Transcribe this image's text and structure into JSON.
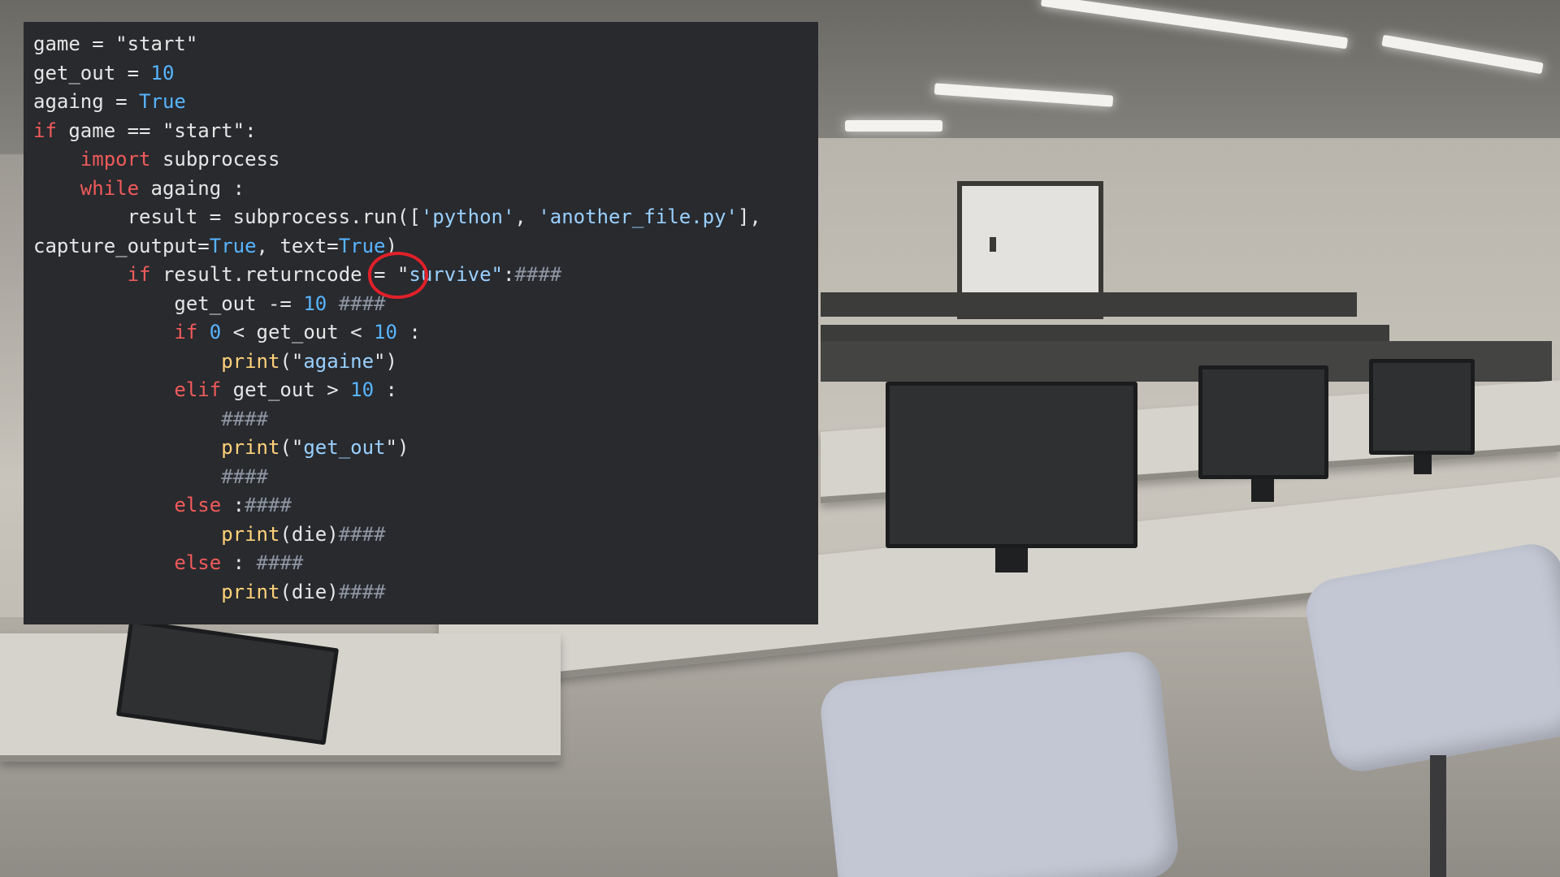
{
  "scene": {
    "description_icon": "computer-lab-photo"
  },
  "code": {
    "lines": [
      {
        "tokens": [
          {
            "t": "game = ",
            "c": "plain"
          },
          {
            "t": "\"start\"",
            "c": "plain"
          }
        ]
      },
      {
        "tokens": [
          {
            "t": "get_out = ",
            "c": "plain"
          },
          {
            "t": "10",
            "c": "num"
          }
        ]
      },
      {
        "tokens": [
          {
            "t": "againg = ",
            "c": "plain"
          },
          {
            "t": "True",
            "c": "bool"
          }
        ]
      },
      {
        "tokens": [
          {
            "t": "if",
            "c": "kw"
          },
          {
            "t": " game == \"start\":",
            "c": "plain"
          }
        ]
      },
      {
        "tokens": [
          {
            "t": "    ",
            "c": "plain"
          },
          {
            "t": "import",
            "c": "kw"
          },
          {
            "t": " subprocess",
            "c": "plain"
          }
        ]
      },
      {
        "tokens": [
          {
            "t": "    ",
            "c": "plain"
          },
          {
            "t": "while",
            "c": "kw"
          },
          {
            "t": " againg :",
            "c": "plain"
          }
        ]
      },
      {
        "tokens": [
          {
            "t": "        result = subprocess.run([",
            "c": "plain"
          },
          {
            "t": "'python'",
            "c": "str"
          },
          {
            "t": ", ",
            "c": "plain"
          },
          {
            "t": "'another_file.py'",
            "c": "str"
          },
          {
            "t": "],",
            "c": "plain"
          }
        ]
      },
      {
        "tokens": [
          {
            "t": "capture_output=",
            "c": "plain"
          },
          {
            "t": "True",
            "c": "bool"
          },
          {
            "t": ", text=",
            "c": "plain"
          },
          {
            "t": "True",
            "c": "bool"
          },
          {
            "t": ")",
            "c": "plain"
          }
        ]
      },
      {
        "tokens": [
          {
            "t": "        ",
            "c": "plain"
          },
          {
            "t": "if",
            "c": "kw"
          },
          {
            "t": " result.returncode = \"",
            "c": "plain"
          },
          {
            "t": "survive\"",
            "c": "str"
          },
          {
            "t": ":",
            "c": "plain"
          },
          {
            "t": "####",
            "c": "cmt"
          }
        ]
      },
      {
        "tokens": [
          {
            "t": "            get_out -= ",
            "c": "plain"
          },
          {
            "t": "10",
            "c": "num"
          },
          {
            "t": " ####",
            "c": "cmt"
          }
        ]
      },
      {
        "tokens": [
          {
            "t": "            ",
            "c": "plain"
          },
          {
            "t": "if",
            "c": "kw"
          },
          {
            "t": " ",
            "c": "plain"
          },
          {
            "t": "0",
            "c": "num"
          },
          {
            "t": " < get_out < ",
            "c": "plain"
          },
          {
            "t": "10",
            "c": "num"
          },
          {
            "t": " :",
            "c": "plain"
          }
        ]
      },
      {
        "tokens": [
          {
            "t": "                ",
            "c": "plain"
          },
          {
            "t": "print",
            "c": "fn"
          },
          {
            "t": "(\"",
            "c": "plain"
          },
          {
            "t": "againe",
            "c": "str"
          },
          {
            "t": "\")",
            "c": "plain"
          }
        ]
      },
      {
        "tokens": [
          {
            "t": "            ",
            "c": "plain"
          },
          {
            "t": "elif",
            "c": "kw"
          },
          {
            "t": " get_out > ",
            "c": "plain"
          },
          {
            "t": "10",
            "c": "num"
          },
          {
            "t": " :",
            "c": "plain"
          }
        ]
      },
      {
        "tokens": [
          {
            "t": "                ",
            "c": "plain"
          },
          {
            "t": "####",
            "c": "cmt"
          }
        ]
      },
      {
        "tokens": [
          {
            "t": "                ",
            "c": "plain"
          },
          {
            "t": "print",
            "c": "fn"
          },
          {
            "t": "(\"",
            "c": "plain"
          },
          {
            "t": "get_out",
            "c": "str"
          },
          {
            "t": "\")",
            "c": "plain"
          }
        ]
      },
      {
        "tokens": [
          {
            "t": "                ",
            "c": "plain"
          },
          {
            "t": "####",
            "c": "cmt"
          }
        ]
      },
      {
        "tokens": [
          {
            "t": "            ",
            "c": "plain"
          },
          {
            "t": "else",
            "c": "kw"
          },
          {
            "t": " :",
            "c": "plain"
          },
          {
            "t": "####",
            "c": "cmt"
          }
        ]
      },
      {
        "tokens": [
          {
            "t": "                ",
            "c": "plain"
          },
          {
            "t": "print",
            "c": "fn"
          },
          {
            "t": "(die)",
            "c": "plain"
          },
          {
            "t": "####",
            "c": "cmt"
          }
        ]
      },
      {
        "tokens": [
          {
            "t": "            ",
            "c": "plain"
          },
          {
            "t": "else",
            "c": "kw"
          },
          {
            "t": " : ",
            "c": "plain"
          },
          {
            "t": "####",
            "c": "cmt"
          }
        ]
      },
      {
        "tokens": [
          {
            "t": "                ",
            "c": "plain"
          },
          {
            "t": "print",
            "c": "fn"
          },
          {
            "t": "(die)",
            "c": "plain"
          },
          {
            "t": "####",
            "c": "cmt"
          }
        ]
      }
    ]
  },
  "colors": {
    "panel_bg": "#282a2e",
    "keyword": "#f15a5a",
    "string": "#9ad0ff",
    "number": "#58b4ff",
    "builtin_fn": "#ffd27a",
    "comment": "#8e96a3",
    "annotation": "#e0202a"
  }
}
